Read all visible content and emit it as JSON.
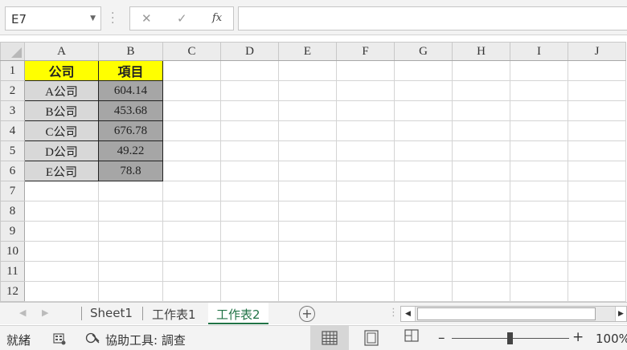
{
  "formula_bar": {
    "name_box": "E7",
    "cancel_glyph": "✕",
    "enter_glyph": "✓",
    "function_label": "fx",
    "formula": ""
  },
  "grid": {
    "columns": [
      "A",
      "B",
      "C",
      "D",
      "E",
      "F",
      "G",
      "H",
      "I",
      "J"
    ],
    "rows": [
      "1",
      "2",
      "3",
      "4",
      "5",
      "6",
      "7",
      "8",
      "9",
      "10",
      "11",
      "12"
    ],
    "header": {
      "a": "公司",
      "b": "項目"
    },
    "data": [
      {
        "a": "A公司",
        "b": "604.14"
      },
      {
        "a": "B公司",
        "b": "453.68"
      },
      {
        "a": "C公司",
        "b": "676.78"
      },
      {
        "a": "D公司",
        "b": "49.22"
      },
      {
        "a": "E公司",
        "b": "78.8"
      }
    ]
  },
  "sheets": {
    "tabs": [
      "Sheet1",
      "工作表1",
      "工作表2"
    ],
    "active": "工作表2"
  },
  "status": {
    "mode": "就緒",
    "accessibility": "協助工具: 調查",
    "zoom": "100%"
  },
  "colors": {
    "header_fill": "#ffff00",
    "company_fill": "#d8d8d8",
    "value_fill": "#a6a6a6",
    "active_tab": "#217346"
  },
  "icons": [
    "chevron-down-icon",
    "cancel-icon",
    "enter-icon",
    "function-icon",
    "select-all-icon",
    "prev-sheet-icon",
    "next-sheet-icon",
    "add-sheet-icon",
    "macro-record-icon",
    "accessibility-icon",
    "normal-view-icon",
    "page-layout-icon",
    "page-break-icon"
  ]
}
